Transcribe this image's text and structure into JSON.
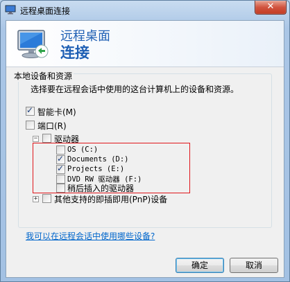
{
  "window": {
    "title": "远程桌面连接",
    "close_glyph": "✕"
  },
  "header": {
    "title_line1": "远程桌面",
    "title_line2": "连接"
  },
  "group": {
    "label": "本地设备和资源"
  },
  "description": "选择要在远程会话中使用的这台计算机上的设备和资源。",
  "devices": {
    "smartcard": {
      "label": "智能卡(M)",
      "checked": true
    },
    "ports": {
      "label": "端口(R)",
      "checked": false
    },
    "drives": {
      "label": "驱动器",
      "expander": "−",
      "items": [
        {
          "label": "OS (C:)",
          "checked": false
        },
        {
          "label": "Documents (D:)",
          "checked": true
        },
        {
          "label": "Projects (E:)",
          "checked": true
        },
        {
          "label": "DVD RW 驱动器 (F:)",
          "checked": false
        },
        {
          "label": "稍后插入的驱动器",
          "checked": false
        }
      ]
    },
    "pnp": {
      "label": "其他支持的即插即用(PnP)设备",
      "expander": "+",
      "checked": false
    }
  },
  "link": "我可以在远程会话中使用哪些设备?",
  "buttons": {
    "ok": "确定",
    "cancel": "取消"
  },
  "colors": {
    "title_blue": "#1e5fb4",
    "link": "#0066cc",
    "highlight_border": "#e0151a"
  }
}
